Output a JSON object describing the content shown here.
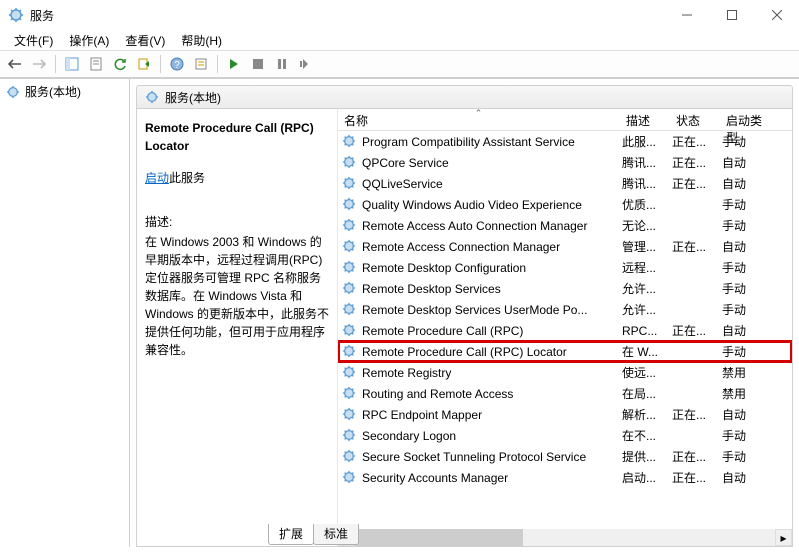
{
  "window": {
    "title": "服务"
  },
  "menu": {
    "file": "文件(F)",
    "action": "操作(A)",
    "view": "查看(V)",
    "help": "帮助(H)"
  },
  "tree": {
    "root": "服务(本地)"
  },
  "paneheader": "服务(本地)",
  "detail": {
    "name": "Remote Procedure Call (RPC) Locator",
    "start_link": "启动",
    "start_suffix": "此服务",
    "desc_label": "描述:",
    "desc": "在 Windows 2003 和 Windows 的早期版本中，远程过程调用(RPC)定位器服务可管理 RPC 名称服务数据库。在 Windows Vista 和 Windows 的更新版本中，此服务不提供任何功能，但可用于应用程序兼容性。"
  },
  "columns": {
    "name": "名称",
    "desc": "描述",
    "status": "状态",
    "startup": "启动类型"
  },
  "services": [
    {
      "name": "Program Compatibility Assistant Service",
      "desc": "此服...",
      "status": "正在...",
      "startup": "手动"
    },
    {
      "name": "QPCore Service",
      "desc": "腾讯...",
      "status": "正在...",
      "startup": "自动"
    },
    {
      "name": "QQLiveService",
      "desc": "腾讯...",
      "status": "正在...",
      "startup": "自动"
    },
    {
      "name": "Quality Windows Audio Video Experience",
      "desc": "优质...",
      "status": "",
      "startup": "手动"
    },
    {
      "name": "Remote Access Auto Connection Manager",
      "desc": "无论...",
      "status": "",
      "startup": "手动"
    },
    {
      "name": "Remote Access Connection Manager",
      "desc": "管理...",
      "status": "正在...",
      "startup": "自动"
    },
    {
      "name": "Remote Desktop Configuration",
      "desc": "远程...",
      "status": "",
      "startup": "手动"
    },
    {
      "name": "Remote Desktop Services",
      "desc": "允许...",
      "status": "",
      "startup": "手动"
    },
    {
      "name": "Remote Desktop Services UserMode Po...",
      "desc": "允许...",
      "status": "",
      "startup": "手动"
    },
    {
      "name": "Remote Procedure Call (RPC)",
      "desc": "RPC...",
      "status": "正在...",
      "startup": "自动"
    },
    {
      "name": "Remote Procedure Call (RPC) Locator",
      "desc": "在 W...",
      "status": "",
      "startup": "手动",
      "highlight": true
    },
    {
      "name": "Remote Registry",
      "desc": "使远...",
      "status": "",
      "startup": "禁用"
    },
    {
      "name": "Routing and Remote Access",
      "desc": "在局...",
      "status": "",
      "startup": "禁用"
    },
    {
      "name": "RPC Endpoint Mapper",
      "desc": "解析...",
      "status": "正在...",
      "startup": "自动"
    },
    {
      "name": "Secondary Logon",
      "desc": "在不...",
      "status": "",
      "startup": "手动"
    },
    {
      "name": "Secure Socket Tunneling Protocol Service",
      "desc": "提供...",
      "status": "正在...",
      "startup": "手动"
    },
    {
      "name": "Security Accounts Manager",
      "desc": "启动...",
      "status": "正在...",
      "startup": "自动"
    }
  ],
  "tabs": {
    "extended": "扩展",
    "standard": "标准"
  }
}
